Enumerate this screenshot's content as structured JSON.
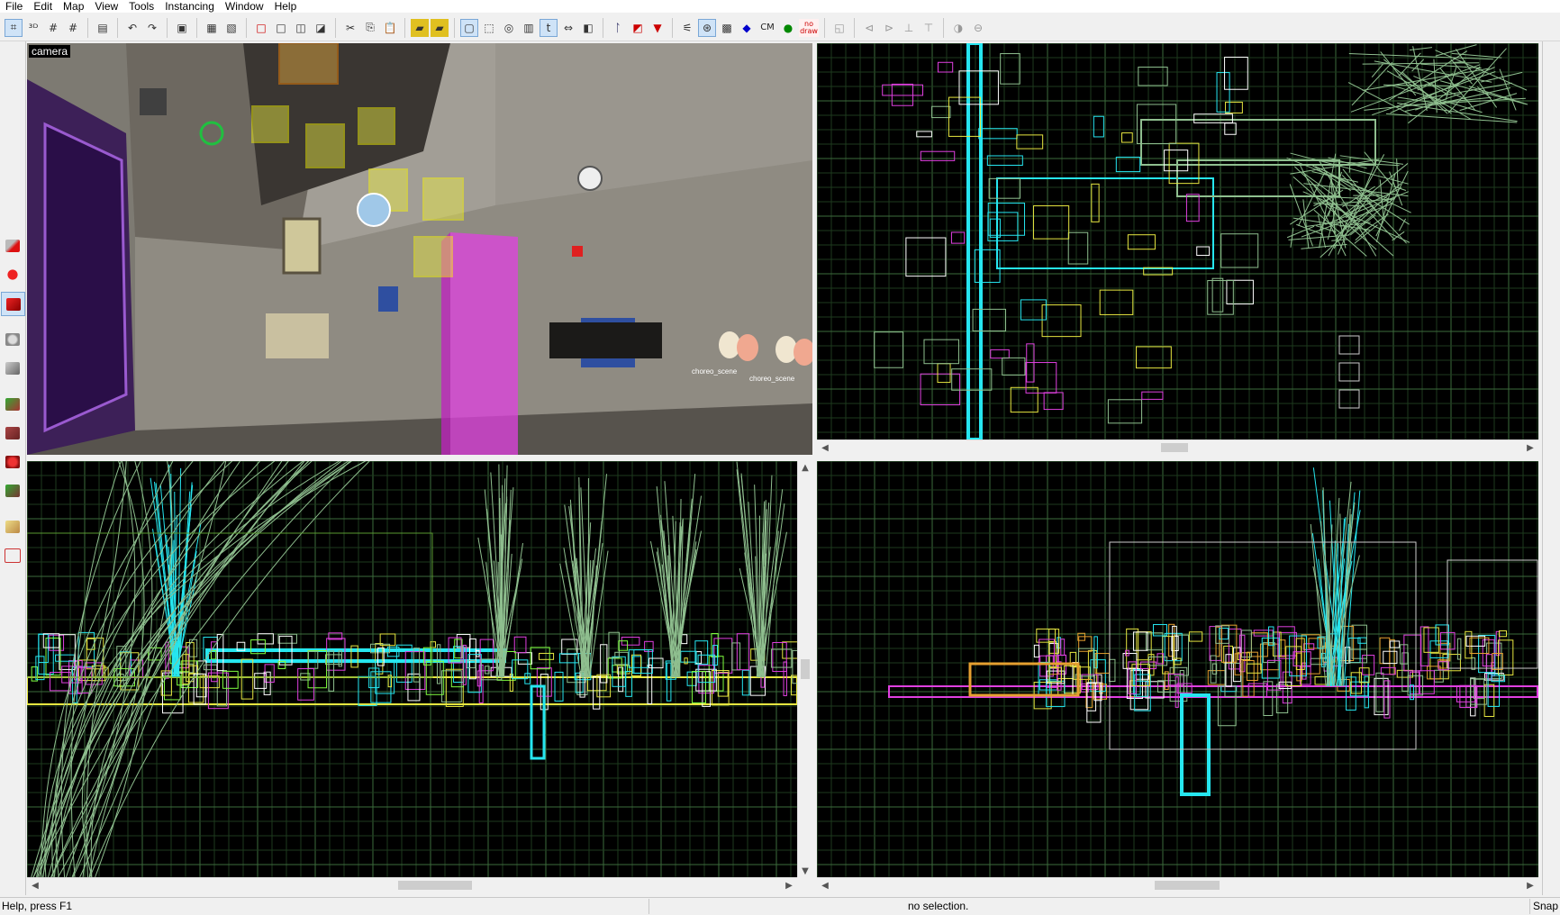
{
  "menu": [
    "File",
    "Edit",
    "Map",
    "View",
    "Tools",
    "Instancing",
    "Window",
    "Help"
  ],
  "toolbar": {
    "cm_label": "CM",
    "nodraw_label": "no draw"
  },
  "viewports": {
    "camera_label": "camera",
    "camera_scene_labels": [
      "choreo_scene",
      "choreo_scene"
    ]
  },
  "status": {
    "help": "Help, press F1",
    "selection": "no selection.",
    "snap": "Snap"
  },
  "colors": {
    "grid_minor": "#1e3a1e",
    "grid_major": "#3c6b3c",
    "cyan": "#26e6f0",
    "brush_green": "#8fbf8f",
    "yellow": "#e6e640",
    "magenta": "#e040e0"
  }
}
